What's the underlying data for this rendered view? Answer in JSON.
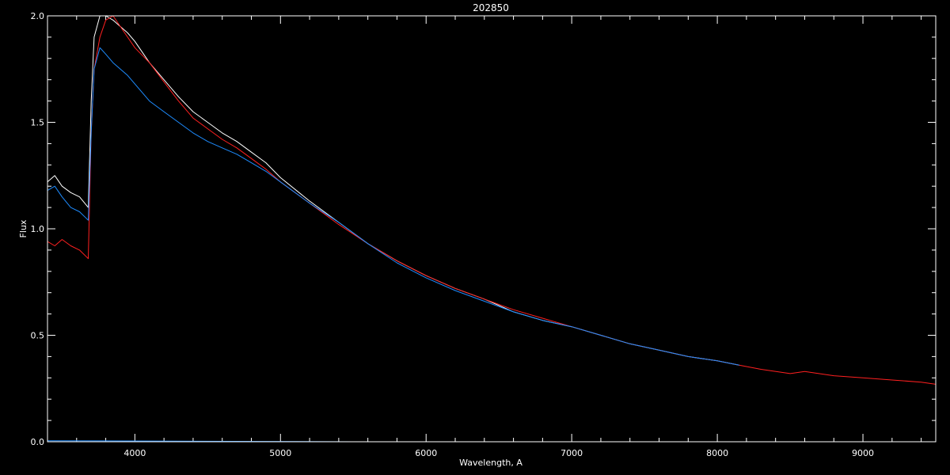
{
  "chart_data": {
    "type": "line",
    "title": "202850",
    "xlabel": "Wavelength, A",
    "ylabel": "Flux",
    "xlim": [
      3400,
      9500
    ],
    "ylim": [
      0.0,
      2.0
    ],
    "grid": false,
    "background": "#000000",
    "xticks": [
      {
        "value": 4000,
        "label": "4000"
      },
      {
        "value": 5000,
        "label": "5000"
      },
      {
        "value": 6000,
        "label": "6000"
      },
      {
        "value": 7000,
        "label": "7000"
      },
      {
        "value": 8000,
        "label": "8000"
      },
      {
        "value": 9000,
        "label": "9000"
      }
    ],
    "yticks": [
      {
        "value": 0.0,
        "label": "0.0"
      },
      {
        "value": 0.5,
        "label": "0.5"
      },
      {
        "value": 1.0,
        "label": "1.0"
      },
      {
        "value": 1.5,
        "label": "1.5"
      },
      {
        "value": 2.0,
        "label": "2.0"
      }
    ],
    "series": [
      {
        "color": "#ffffff",
        "x": [
          3400,
          3450,
          3500,
          3560,
          3620,
          3680,
          3700,
          3720,
          3760,
          3800,
          3850,
          3900,
          3950,
          4000,
          4100,
          4200,
          4300,
          4400,
          4500,
          4600,
          4700,
          4800,
          4900,
          5000,
          5200,
          5400,
          5600,
          5800,
          6000,
          6200,
          6400,
          6600,
          6800,
          7000,
          7200,
          7400,
          7600,
          7800,
          8000,
          8150
        ],
        "y": [
          1.22,
          1.25,
          1.2,
          1.17,
          1.15,
          1.1,
          1.6,
          1.9,
          2.0,
          2.0,
          1.98,
          1.95,
          1.92,
          1.88,
          1.78,
          1.7,
          1.62,
          1.55,
          1.5,
          1.45,
          1.41,
          1.36,
          1.31,
          1.24,
          1.13,
          1.03,
          0.93,
          0.85,
          0.78,
          0.72,
          0.67,
          0.61,
          0.57,
          0.54,
          0.5,
          0.46,
          0.43,
          0.4,
          0.38,
          0.36
        ]
      },
      {
        "color": "#ff2020",
        "x": [
          3400,
          3450,
          3500,
          3560,
          3620,
          3680,
          3700,
          3720,
          3760,
          3800,
          3850,
          3900,
          3950,
          4000,
          4100,
          4200,
          4300,
          4400,
          4500,
          4600,
          4700,
          4800,
          4900,
          5000,
          5200,
          5400,
          5600,
          5800,
          6000,
          6200,
          6400,
          6600,
          6800,
          7000,
          7200,
          7400,
          7600,
          7800,
          8000,
          8150,
          8300,
          8500,
          8600,
          8800,
          9000,
          9200,
          9400,
          9500
        ],
        "y": [
          0.94,
          0.92,
          0.95,
          0.92,
          0.9,
          0.86,
          1.45,
          1.75,
          1.9,
          1.98,
          2.0,
          1.95,
          1.9,
          1.85,
          1.78,
          1.69,
          1.6,
          1.52,
          1.47,
          1.42,
          1.38,
          1.33,
          1.28,
          1.22,
          1.12,
          1.02,
          0.93,
          0.85,
          0.78,
          0.72,
          0.67,
          0.62,
          0.58,
          0.54,
          0.5,
          0.46,
          0.43,
          0.4,
          0.38,
          0.36,
          0.34,
          0.32,
          0.33,
          0.31,
          0.3,
          0.29,
          0.28,
          0.27
        ]
      },
      {
        "color": "#1e8cff",
        "x": [
          3400,
          3450,
          3500,
          3560,
          3620,
          3680,
          3700,
          3720,
          3760,
          3800,
          3850,
          3900,
          3950,
          4000,
          4100,
          4200,
          4300,
          4400,
          4500,
          4600,
          4700,
          4800,
          4900,
          5000,
          5200,
          5400,
          5600,
          5800,
          6000,
          6200,
          6400,
          6600,
          6800,
          7000,
          7200,
          7400,
          7600,
          7800,
          8000,
          8150
        ],
        "y": [
          1.18,
          1.2,
          1.15,
          1.1,
          1.08,
          1.04,
          1.45,
          1.75,
          1.85,
          1.82,
          1.78,
          1.75,
          1.72,
          1.68,
          1.6,
          1.55,
          1.5,
          1.45,
          1.41,
          1.38,
          1.35,
          1.31,
          1.27,
          1.22,
          1.12,
          1.03,
          0.93,
          0.84,
          0.77,
          0.71,
          0.66,
          0.61,
          0.57,
          0.54,
          0.5,
          0.46,
          0.43,
          0.4,
          0.38,
          0.36
        ]
      },
      {
        "color": "#1e8cff",
        "x": [
          3400,
          5500,
          8150
        ],
        "y": [
          0.005,
          0.0,
          0.0
        ]
      }
    ]
  }
}
